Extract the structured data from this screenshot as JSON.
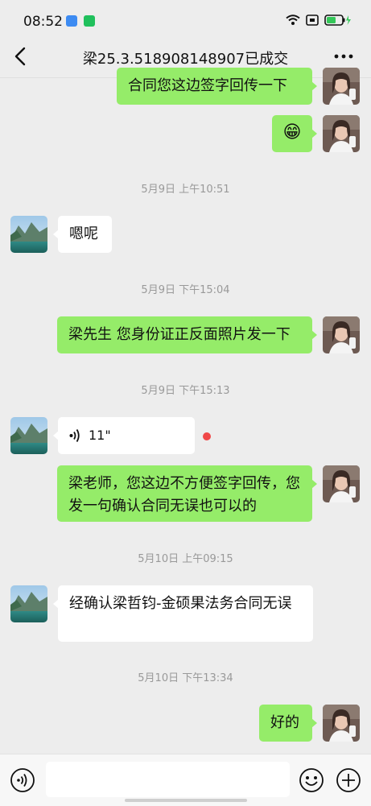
{
  "status_bar": {
    "time": "08:52",
    "battery_color": "#34c759"
  },
  "header": {
    "title": "梁25.3.518908148907已成交"
  },
  "messages": {
    "m1": "合同您这边签字回传一下",
    "m2": "😁",
    "t1": "5月9日 上午10:51",
    "m3": "嗯呢",
    "t2": "5月9日 下午15:04",
    "m4": "梁先生 您身份证正反面照片发一下",
    "t3": "5月9日 下午15:13",
    "m5_voice_duration": "11\"",
    "m6": "梁老师，您这边不方便签字回传，您发一句确认合同无误也可以的",
    "t4": "5月10日 上午09:15",
    "m7": "经确认梁哲钧-金硕果法务合同无误",
    "t5": "5月10日 下午13:34",
    "m8": "好的"
  },
  "input_bar": {
    "placeholder": ""
  },
  "colors": {
    "outgoing_bubble": "#95ec69",
    "incoming_bubble": "#ffffff",
    "background": "#ededed"
  }
}
